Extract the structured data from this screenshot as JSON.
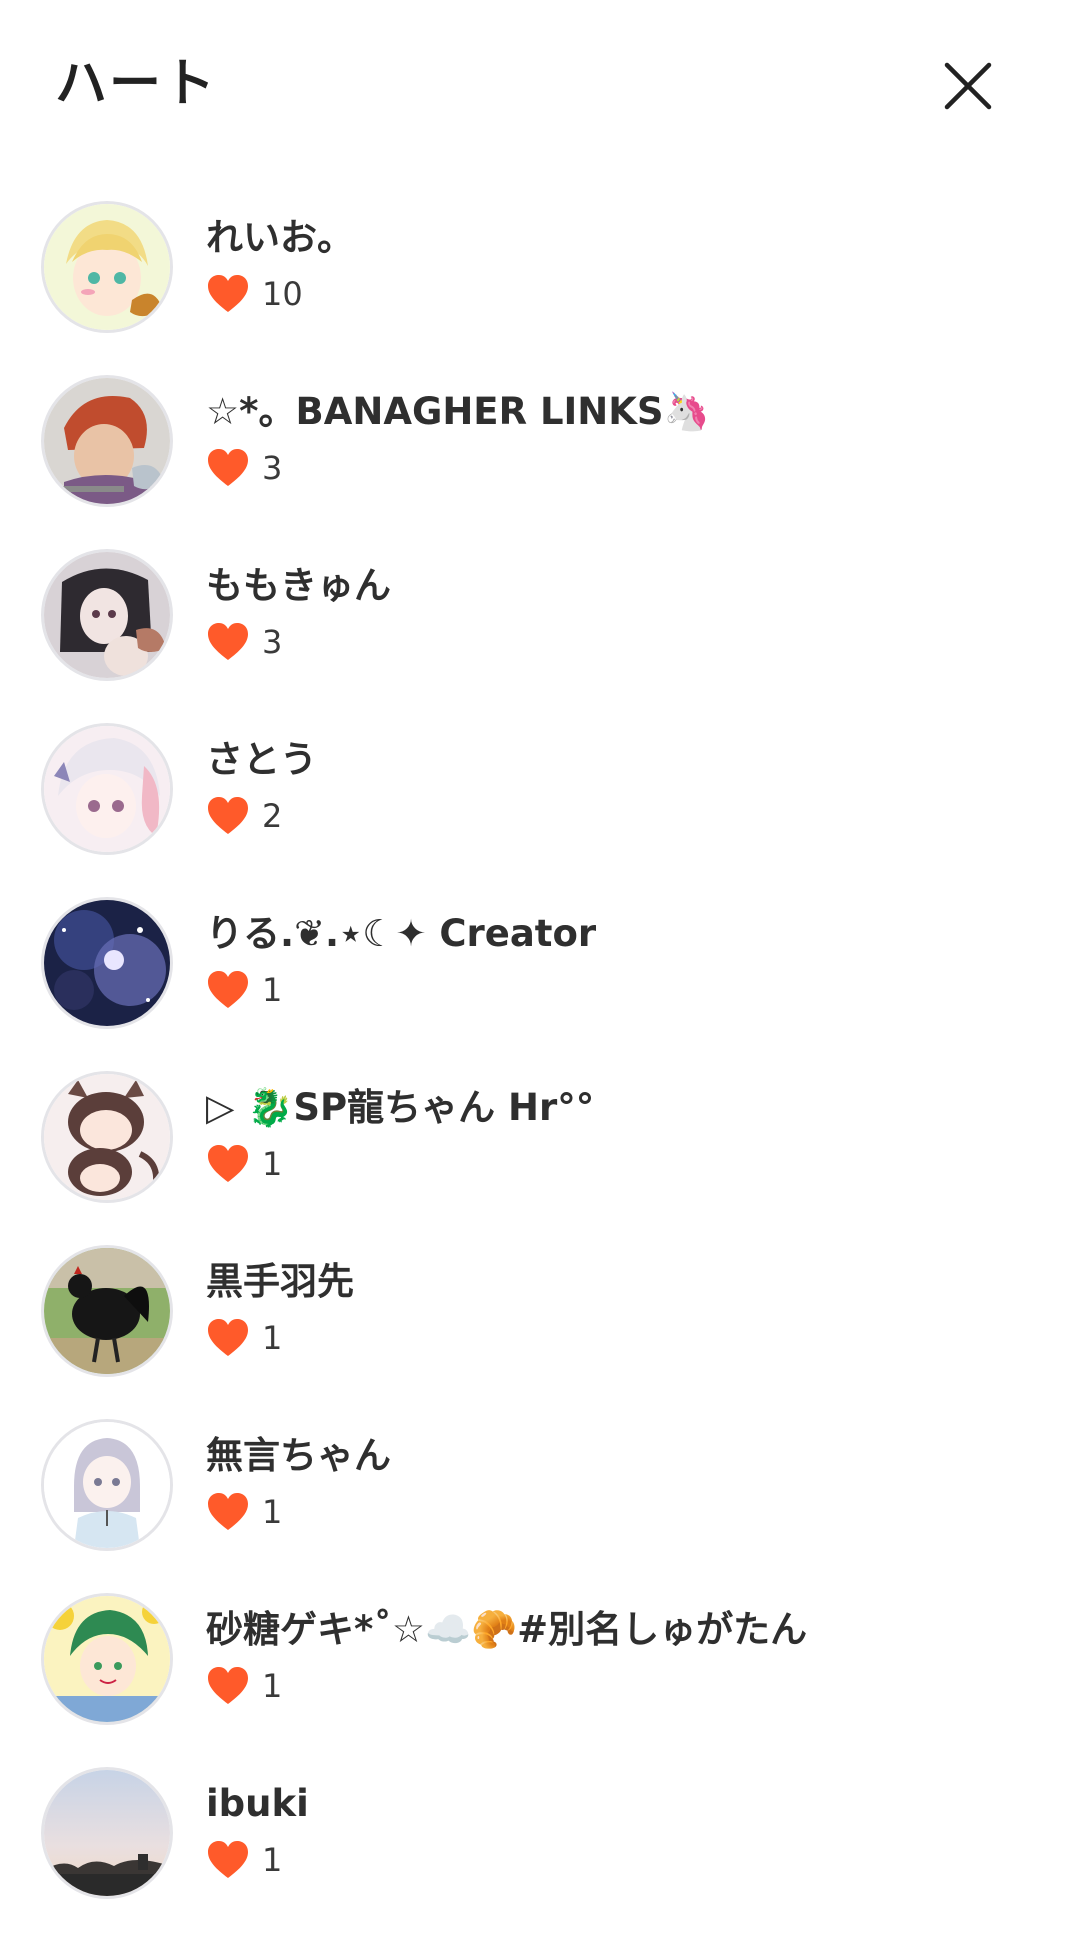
{
  "header": {
    "title": "ハート",
    "close_icon": "close-icon"
  },
  "colors": {
    "heart": "#ff5a2a",
    "text": "#2f2f2f",
    "avatar_ring": "#e4e4e8"
  },
  "likers": [
    {
      "name": "れいお。",
      "count": "10"
    },
    {
      "name": "☆*。BANAGHER LINKS🦄",
      "count": "3"
    },
    {
      "name": "ももきゅん",
      "count": "3"
    },
    {
      "name": "さとう",
      "count": "2"
    },
    {
      "name": "りる.❦.⋆☾✦ Creator",
      "count": "1"
    },
    {
      "name": "▷ 🐉SP龍ちゃん Hr°°",
      "count": "1"
    },
    {
      "name": "黒手羽先",
      "count": "1"
    },
    {
      "name": "無言ちゃん",
      "count": "1"
    },
    {
      "name": "砂糖ゲキ*˚☆☁️🥐#別名しゅがたん",
      "count": "1"
    },
    {
      "name": "ibuki",
      "count": "1"
    }
  ]
}
